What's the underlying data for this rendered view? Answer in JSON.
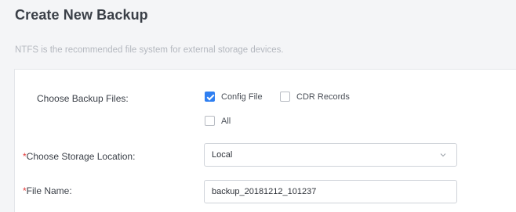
{
  "page": {
    "title": "Create New Backup",
    "hint": "NTFS is the recommended file system for external storage devices."
  },
  "form": {
    "backup_files": {
      "label": "Choose Backup Files:",
      "options": [
        {
          "label": "Config File",
          "checked": true
        },
        {
          "label": "CDR Records",
          "checked": false
        },
        {
          "label": "All",
          "checked": false
        }
      ]
    },
    "storage_location": {
      "required_mark": "*",
      "label": "Choose Storage Location:",
      "value": "Local"
    },
    "file_name": {
      "required_mark": "*",
      "label": "File Name:",
      "value": "backup_20181212_101237"
    }
  },
  "colors": {
    "accent": "#2f7ff1",
    "required": "#e23b3b"
  },
  "icons": {
    "dropdown": "chevron-down-icon",
    "checkmark": "check-icon"
  }
}
